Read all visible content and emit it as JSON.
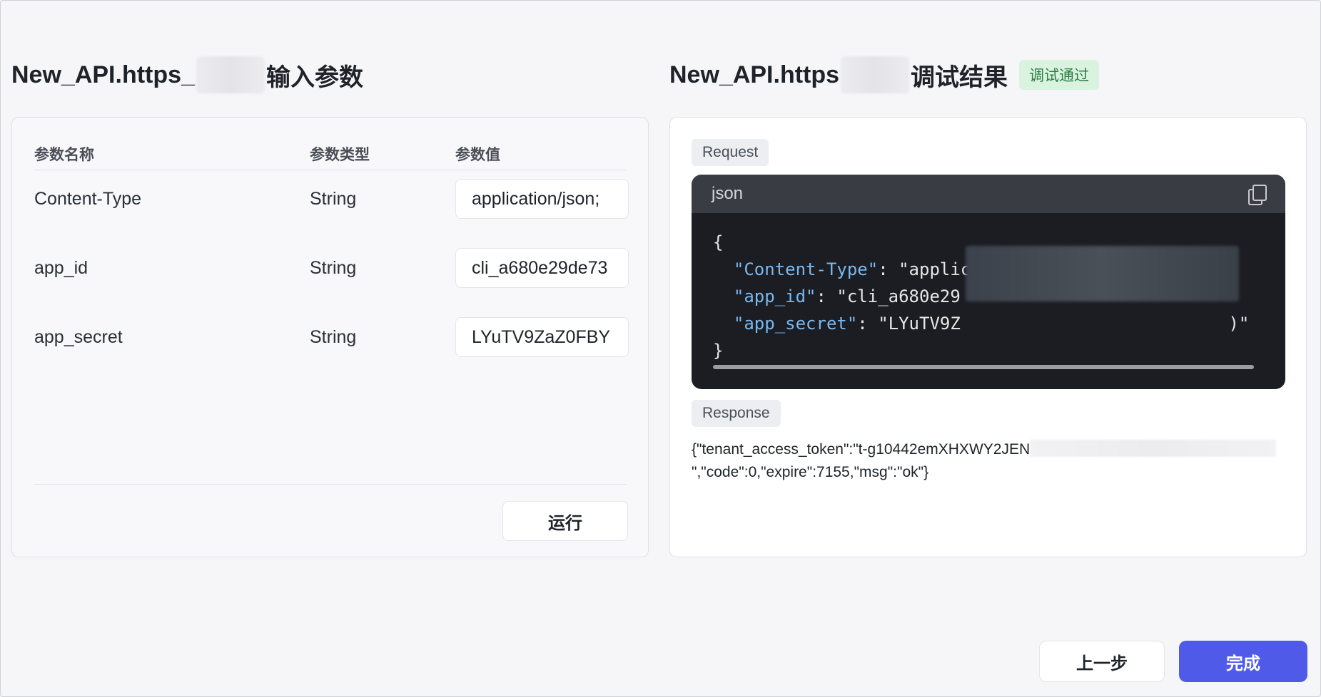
{
  "left": {
    "title_prefix": "New_API.https_",
    "title_suffix": "输入参数",
    "columns": [
      "参数名称",
      "参数类型",
      "参数值"
    ],
    "rows": [
      {
        "name": "Content-Type",
        "type": "String",
        "value": "application/json;"
      },
      {
        "name": "app_id",
        "type": "String",
        "value": "cli_a680e29de73"
      },
      {
        "name": "app_secret",
        "type": "String",
        "value": "LYuTV9ZaZ0FBY"
      }
    ],
    "run_label": "运行"
  },
  "right": {
    "title_prefix": "New_API.https",
    "title_suffix": "调试结果",
    "status_badge": "调试通过",
    "request_label": "Request",
    "code_lang": "json",
    "code": {
      "open": "{",
      "line1_key": "\"Content-Type\"",
      "line1_val": "\"application/json; charset=utf-8\"",
      "line2_key": "\"app_id\"",
      "line2_val": "\"cli_a680e29",
      "line3_key": "\"app_secret\"",
      "line3_val": "\"LYuTV9Z",
      "line3_tail": ")\"",
      "close": "}"
    },
    "response_label": "Response",
    "response_part1": "{\"tenant_access_token\":\"t-g10442emXHXWY2JEN",
    "response_part2": "\",\"code\":0,\"expire\":7155,\"msg\":\"ok\"}"
  },
  "footer": {
    "prev_label": "上一步",
    "done_label": "完成"
  },
  "colors": {
    "primary": "#4f5be8",
    "success_bg": "#d9f3df",
    "success_text": "#2e7d46",
    "code_bg": "#1b1d22",
    "code_key": "#7ab8f0"
  }
}
